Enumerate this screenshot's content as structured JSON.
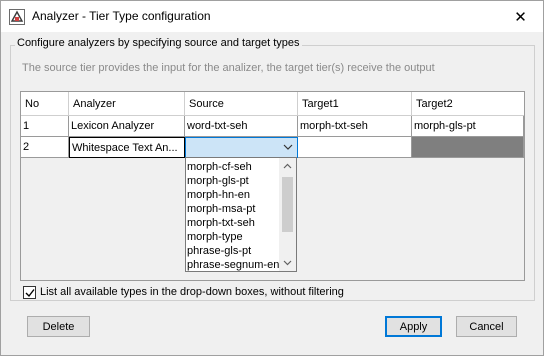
{
  "window": {
    "title": "Analyzer - Tier Type configuration",
    "close_glyph": "✕"
  },
  "group": {
    "title": "Configure analyzers by specifying source and target types",
    "info": "The source tier provides the input for the analizer, the target tier(s) receive the output"
  },
  "table": {
    "columns": [
      "No",
      "Analyzer",
      "Source",
      "Target1",
      "Target2"
    ],
    "rows": [
      {
        "no": "1",
        "analyzer": "Lexicon Analyzer",
        "source": "word-txt-seh",
        "target1": "morph-txt-seh",
        "target2": "morph-gls-pt"
      },
      {
        "no": "2",
        "analyzer": "Whitespace Text An...",
        "source": "",
        "target1": "",
        "target2": ""
      }
    ]
  },
  "dropdown": {
    "options": [
      "morph-cf-seh",
      "morph-gls-pt",
      "morph-hn-en",
      "morph-msa-pt",
      "morph-txt-seh",
      "morph-type",
      "phrase-gls-pt",
      "phrase-segnum-en"
    ]
  },
  "filter_checkbox": {
    "label": "List all available types in the drop-down boxes, without filtering",
    "checked": true
  },
  "buttons": {
    "delete": "Delete",
    "apply": "Apply",
    "cancel": "Cancel"
  },
  "colors": {
    "selected_combo": "#cce4f7",
    "disabled_cell": "#7f7f7f",
    "focus_border": "#0078d7"
  }
}
